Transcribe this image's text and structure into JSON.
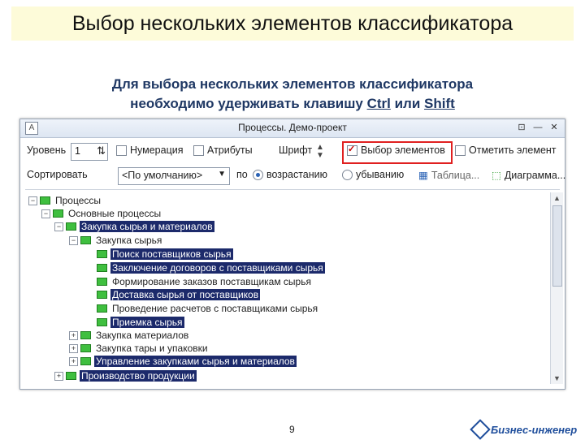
{
  "slide": {
    "title": "Выбор нескольких элементов классификатора",
    "subtitle_line1": "Для выбора нескольких элементов классификатора",
    "subtitle_line2_prefix": "необходимо удерживать клавишу ",
    "subtitle_key1": "Ctrl",
    "subtitle_or": " или ",
    "subtitle_key2": "Shift",
    "page_number": "9",
    "logo_text": "Бизнес-инженер"
  },
  "window": {
    "caption": "Процессы. Демо-проект",
    "buttons": [
      "⊡",
      "—",
      "✕"
    ]
  },
  "toolbar1": {
    "level_label": "Уровень",
    "level_value": "1",
    "numbering_label": "Нумерация",
    "attributes_label": "Атрибуты",
    "font_label": "Шрифт",
    "select_elements_label": "Выбор элементов",
    "mark_element_label": "Отметить элемент"
  },
  "toolbar2": {
    "sort_label": "Сортировать",
    "sort_value": "<По умолчанию>",
    "by_label": "по",
    "ascending_label": "возрастанию",
    "descending_label": "убыванию",
    "table_label": "Таблица...",
    "diagram_label": "Диаграмма..."
  },
  "tree": [
    {
      "label": "Процессы",
      "selected": false
    },
    {
      "label": "Основные процессы",
      "selected": false
    },
    {
      "label": "Закупка сырья и материалов",
      "selected": true
    },
    {
      "label": "Закупка сырья",
      "selected": false
    },
    {
      "label": "Поиск поставщиков сырья",
      "selected": true
    },
    {
      "label": "Заключение договоров с поставщиками сырья",
      "selected": true
    },
    {
      "label": "Формирование заказов поставщикам сырья",
      "selected": false
    },
    {
      "label": "Доставка сырья от поставщиков",
      "selected": true
    },
    {
      "label": "Проведение расчетов с поставщиками сырья",
      "selected": false
    },
    {
      "label": "Приемка сырья",
      "selected": true
    },
    {
      "label": "Закупка материалов",
      "selected": false
    },
    {
      "label": "Закупка тары и упаковки",
      "selected": false
    },
    {
      "label": "Управление закупками сырья и материалов",
      "selected": true
    },
    {
      "label": "Производство продукции",
      "selected": true
    }
  ],
  "colors": {
    "selection": "#1c2a6b",
    "title_bg": "#fdfbd9",
    "highlight_border": "#e02020",
    "node_icon": "#3fbf3f"
  }
}
